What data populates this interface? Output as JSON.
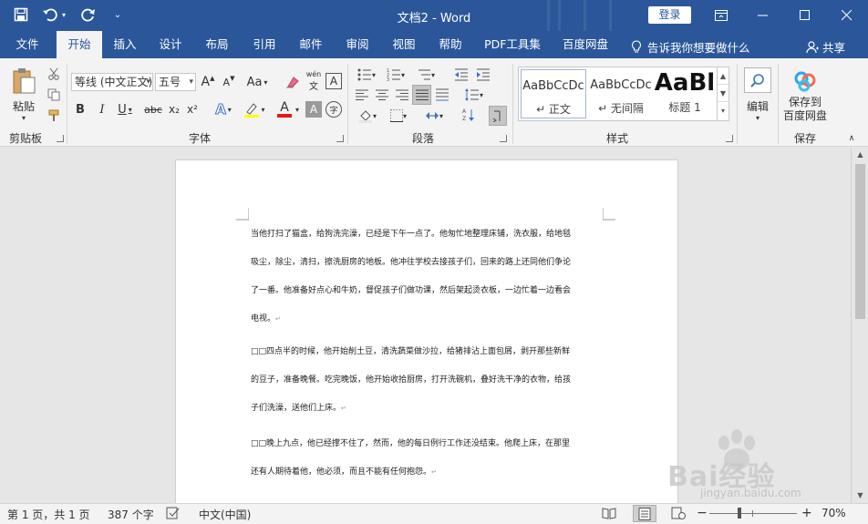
{
  "titlebar": {
    "title": "文档2  -  Word",
    "login": "登录"
  },
  "tabs": [
    "文件",
    "开始",
    "插入",
    "设计",
    "布局",
    "引用",
    "邮件",
    "审阅",
    "视图",
    "帮助",
    "PDF工具集",
    "百度网盘"
  ],
  "active_tab": "开始",
  "tellme": "告诉我你想要做什么",
  "share": "共享",
  "ribbon": {
    "clipboard": {
      "paste_label": "粘贴",
      "group": "剪贴板"
    },
    "font": {
      "font_name": "等线 (中文正文)",
      "font_size": "五号",
      "group": "字体",
      "grow": "A",
      "shrink": "A",
      "case": "Aa",
      "phonetic": "wén",
      "charborder": "A",
      "bold": "B",
      "italic": "I",
      "underline": "U",
      "strike": "abc",
      "subscript": "x₂",
      "superscript": "x²",
      "effects": "A",
      "highlight": "ab",
      "fontcolor": "A",
      "shading": "A",
      "encircle": "字"
    },
    "paragraph": {
      "group": "段落"
    },
    "styles": {
      "group": "样式",
      "items": [
        {
          "sample": "AaBbCcDc",
          "name": "↵ 正文"
        },
        {
          "sample": "AaBbCcDc",
          "name": "↵ 无间隔"
        },
        {
          "sample": "AaBl",
          "name": "标题 1"
        }
      ]
    },
    "edit": {
      "label": "编辑"
    },
    "save": {
      "label_line1": "保存到",
      "label_line2": "百度网盘",
      "group": "保存"
    }
  },
  "document": {
    "paragraphs": [
      [
        "当他打扫了猫盒，给狗洗完澡，已经是下午一点了。他匆忙地整理床铺，洗衣服，给地毯",
        "吸尘，除尘，清扫，擦洗厨房的地板。他冲往学校去接孩子们，回来的路上还同他们争论",
        "了一番。他准备好点心和牛奶，督促孩子们做功课，然后架起烫衣板，一边忙着一边看会",
        "电视。"
      ],
      [
        "□□四点半的时候，他开始削土豆，清洗蔬菜做沙拉，给猪排沾上面包屑，剥开那些新鲜",
        "的豆子，准备晚餐。吃完晚饭，他开始收拾厨房，打开洗碗机，叠好洗干净的衣物，给孩",
        "子们洗澡，送他们上床。"
      ],
      [
        "□□晚上九点，他已经撑不住了，然而，他的每日例行工作还没结束。他爬上床，在那里",
        "还有人期待着他，他必须，而且不能有任何抱怨。"
      ]
    ]
  },
  "status": {
    "page": "第 1 页，共 1 页",
    "words": "387 个字",
    "language": "中文(中国)",
    "zoom": "70%",
    "minus": "−",
    "plus": "+"
  },
  "watermark": {
    "brand": "Bai经验",
    "url": "jingyan.baidu.com"
  }
}
